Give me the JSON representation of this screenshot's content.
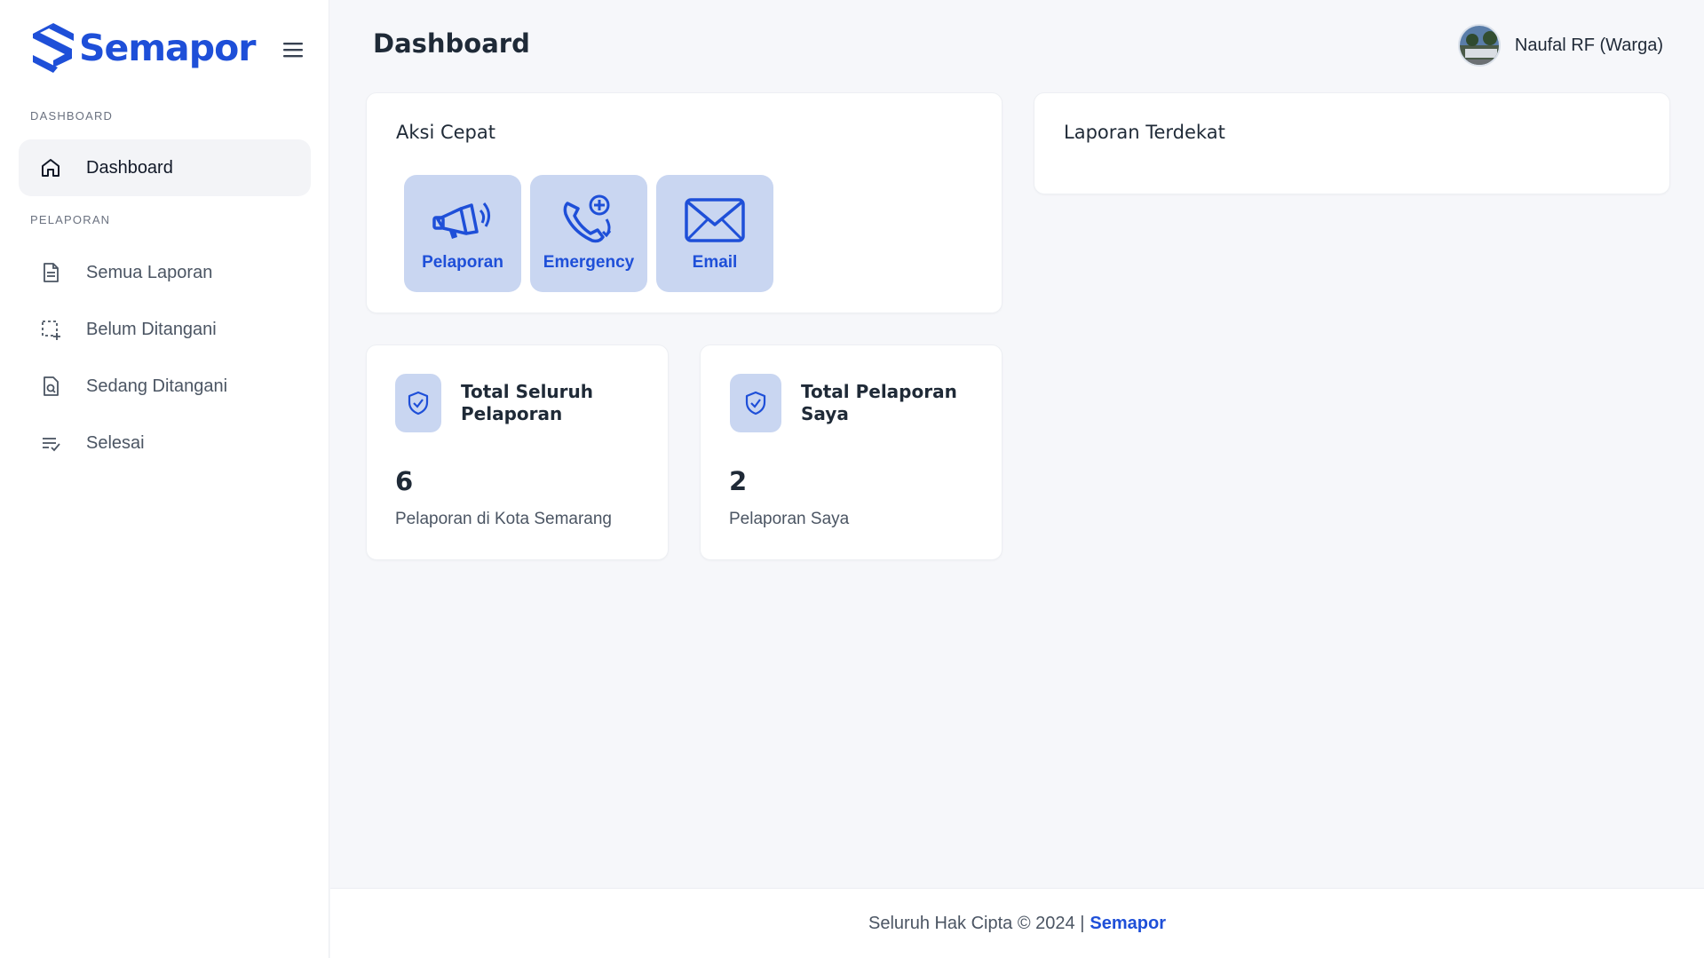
{
  "brand": {
    "name": "Semapor",
    "color": "#1e4fd8"
  },
  "sidebar": {
    "menu_icon": "hamburger-icon",
    "sections": [
      {
        "label": "DASHBOARD"
      },
      {
        "label": "PELAPORAN"
      }
    ],
    "items": [
      {
        "label": "Dashboard",
        "icon": "home-icon",
        "active": true
      },
      {
        "label": "Semua Laporan",
        "icon": "document-icon",
        "active": false
      },
      {
        "label": "Belum Ditangani",
        "icon": "dashed-square-plus-icon",
        "active": false
      },
      {
        "label": "Sedang Ditangani",
        "icon": "document-search-icon",
        "active": false
      },
      {
        "label": "Selesai",
        "icon": "list-check-icon",
        "active": false
      }
    ]
  },
  "header": {
    "title": "Dashboard",
    "user": {
      "name": "Naufal RF (Warga)",
      "avatar": "avatar-photo"
    }
  },
  "quick_actions": {
    "title": "Aksi Cepat",
    "buttons": [
      {
        "label": "Pelaporan",
        "icon": "megaphone-icon"
      },
      {
        "label": "Emergency",
        "icon": "phone-plus-icon"
      },
      {
        "label": "Email",
        "icon": "envelope-icon"
      }
    ]
  },
  "nearby_reports": {
    "title": "Laporan Terdekat"
  },
  "stats": [
    {
      "title": "Total Seluruh Pelaporan",
      "value": "6",
      "caption": "Pelaporan di Kota Semarang",
      "icon": "shield-check-icon"
    },
    {
      "title": "Total Pelaporan Saya",
      "value": "2",
      "caption": "Pelaporan Saya",
      "icon": "shield-check-icon"
    }
  ],
  "footer": {
    "text": "Seluruh Hak Cipta © 2024 |",
    "link": "Semapor"
  },
  "colors": {
    "accent": "#1e4fd8",
    "tile": "#c9d6f1",
    "background": "#f6f7fa"
  }
}
